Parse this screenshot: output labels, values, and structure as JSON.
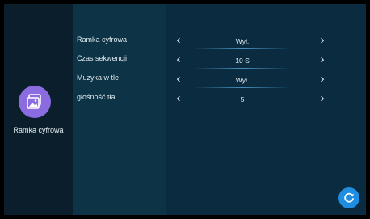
{
  "sidebar": {
    "app_label": "Ramka cyfrowa",
    "app_icon": "gallery-icon",
    "app_icon_color": "#8a6ce0"
  },
  "settings": [
    {
      "label": "Ramka cyfrowa",
      "value": "Wył."
    },
    {
      "label": "Czas sekwencji",
      "value": "10 S"
    },
    {
      "label": "Muzyka w tle",
      "value": "Wył."
    },
    {
      "label": "głośność tła",
      "value": "5"
    }
  ],
  "controls": {
    "prev_icon": "chevron-left-icon",
    "next_icon": "chevron-right-icon",
    "refresh_icon": "refresh-icon",
    "refresh_color": "#1f8de0"
  }
}
